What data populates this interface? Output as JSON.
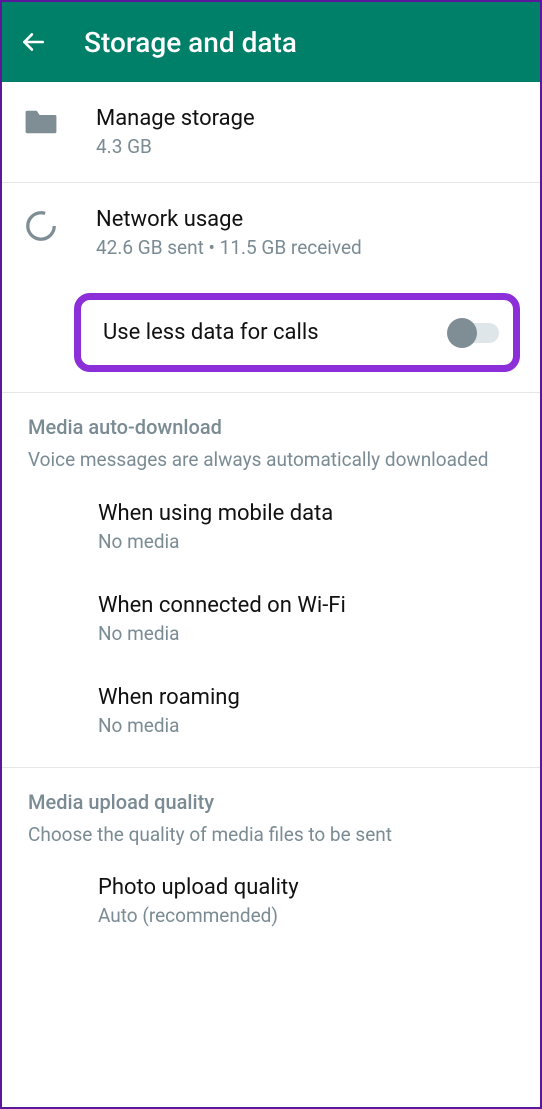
{
  "header": {
    "title": "Storage and data"
  },
  "manage_storage": {
    "title": "Manage storage",
    "subtitle": "4.3 GB"
  },
  "network_usage": {
    "title": "Network usage",
    "subtitle": "42.6 GB sent • 11.5 GB received"
  },
  "less_data": {
    "title": "Use less data for calls"
  },
  "auto_download": {
    "heading": "Media auto-download",
    "description": "Voice messages are always automatically downloaded",
    "mobile": {
      "title": "When using mobile data",
      "subtitle": "No media"
    },
    "wifi": {
      "title": "When connected on Wi-Fi",
      "subtitle": "No media"
    },
    "roaming": {
      "title": "When roaming",
      "subtitle": "No media"
    }
  },
  "upload_quality": {
    "heading": "Media upload quality",
    "description": "Choose the quality of media files to be sent",
    "photo": {
      "title": "Photo upload quality",
      "subtitle": "Auto (recommended)"
    }
  }
}
